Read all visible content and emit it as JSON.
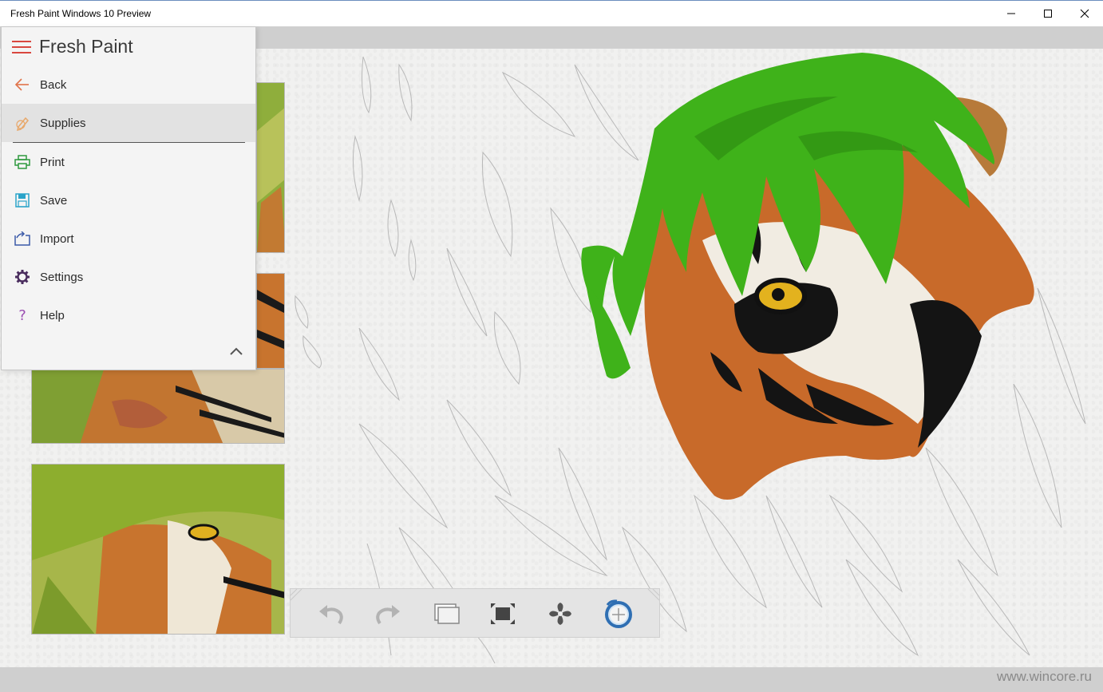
{
  "window": {
    "title": "Fresh Paint Windows 10 Preview",
    "minimize_icon": "minimize-icon",
    "maximize_icon": "maximize-icon",
    "close_icon": "close-icon"
  },
  "nav": {
    "app_title": "Fresh Paint",
    "menu_icon": "hamburger-icon",
    "items": [
      {
        "label": "Back",
        "icon": "arrow-left-icon",
        "color": "#e0734a"
      },
      {
        "label": "Supplies",
        "icon": "pencil-icon",
        "color": "#e8a86b"
      },
      {
        "label": "Print",
        "icon": "printer-icon",
        "color": "#2e9a3e"
      },
      {
        "label": "Save",
        "icon": "floppy-disk-icon",
        "color": "#2aa3c9"
      },
      {
        "label": "Import",
        "icon": "import-icon",
        "color": "#3b5aa8"
      },
      {
        "label": "Settings",
        "icon": "gear-icon",
        "color": "#4a2d5e"
      },
      {
        "label": "Help",
        "icon": "question-icon",
        "color": "#9b4fb2"
      }
    ],
    "selected": "Supplies",
    "collapse_icon": "chevron-up-icon"
  },
  "toolbar": {
    "tools": [
      "undo-icon",
      "redo-icon",
      "layers-icon",
      "fit-to-screen-icon",
      "fan-dry-icon",
      "color-picker-icon"
    ]
  },
  "watermark": "www.wincore.ru",
  "colors": {
    "accent_red": "#d9473f",
    "paint_green": "#3fb21a",
    "tiger_orange": "#c86a2a"
  }
}
